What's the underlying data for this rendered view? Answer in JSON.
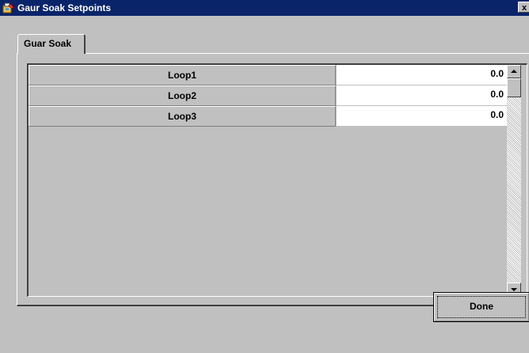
{
  "window": {
    "title": "Gaur Soak Setpoints",
    "close_label": "x"
  },
  "tabs": [
    {
      "label": "Guar Soak"
    }
  ],
  "grid": {
    "rows": [
      {
        "label": "Loop1",
        "value": "0.0"
      },
      {
        "label": "Loop2",
        "value": "0.0"
      },
      {
        "label": "Loop3",
        "value": "0.0"
      }
    ]
  },
  "buttons": {
    "done_label": "Done"
  },
  "colors": {
    "title_bar": "#0a246a",
    "face": "#c0c0c0",
    "cell": "#ffffff"
  },
  "icons": {
    "app": "app-icon",
    "close": "close-icon",
    "scroll_up": "scroll-up-arrow-icon",
    "scroll_down": "scroll-down-arrow-icon"
  }
}
